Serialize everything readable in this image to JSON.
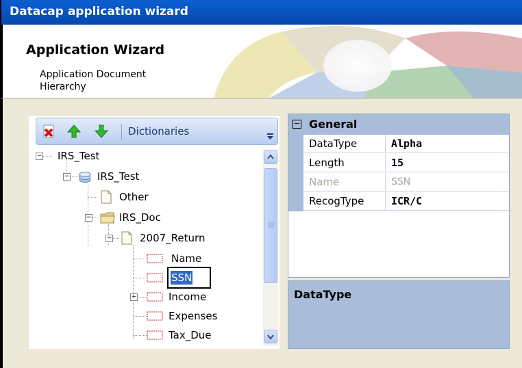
{
  "window": {
    "title": "Datacap application wizard"
  },
  "header": {
    "title": "Application Wizard",
    "subtitle": "Application Document Hierarchy"
  },
  "toolbar": {
    "label": "Dictionaries"
  },
  "tree": {
    "nodes": [
      {
        "label": "IRS_Test",
        "expanded": true
      },
      {
        "label": "IRS_Test",
        "expanded": true,
        "icon": "layers-icon"
      },
      {
        "label": "Other",
        "icon": "page-icon"
      },
      {
        "label": "IRS_Doc",
        "expanded": true,
        "icon": "folder-icon"
      },
      {
        "label": "2007_Return",
        "expanded": true,
        "icon": "page-icon"
      },
      {
        "label": "Name",
        "icon": "field-icon"
      },
      {
        "label": "SSN",
        "icon": "field-icon",
        "editing": true
      },
      {
        "label": "Income",
        "icon": "field-icon",
        "expanded": false
      },
      {
        "label": "Expenses",
        "icon": "field-icon"
      },
      {
        "label": "Tax_Due",
        "icon": "field-icon"
      }
    ]
  },
  "properties": {
    "category": "General",
    "rows": [
      {
        "key": "DataType",
        "value": "Alpha",
        "enabled": true
      },
      {
        "key": "Length",
        "value": "15",
        "enabled": true
      },
      {
        "key": "Name",
        "value": "SSN",
        "enabled": false
      },
      {
        "key": "RecogType",
        "value": "ICR/C",
        "enabled": true
      }
    ]
  },
  "help": {
    "title": "DataType"
  },
  "colors": {
    "titlebar": "#0a5fd0",
    "grid_header": "#a9bcd9",
    "selection": "#316ac5"
  }
}
